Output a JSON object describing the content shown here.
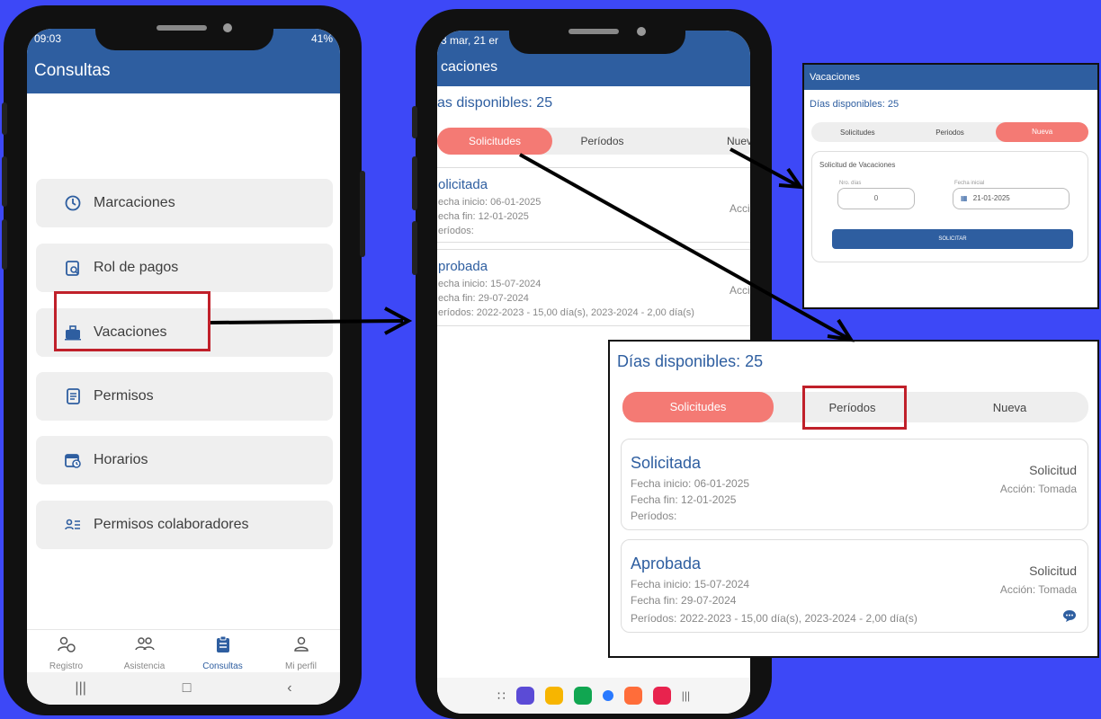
{
  "phone1": {
    "status_time": "09:03",
    "status_battery": "41%",
    "title": "Consultas",
    "menu": [
      {
        "label": "Marcaciones",
        "icon": "clock-check-icon"
      },
      {
        "label": "Rol de pagos",
        "icon": "clipboard-search-icon"
      },
      {
        "label": "Vacaciones",
        "icon": "suitcase-icon"
      },
      {
        "label": "Permisos",
        "icon": "document-icon"
      },
      {
        "label": "Horarios",
        "icon": "calendar-clock-icon"
      },
      {
        "label": "Permisos colaboradores",
        "icon": "users-list-icon"
      }
    ],
    "nav": [
      {
        "label": "Registro",
        "icon": "user-clock-icon"
      },
      {
        "label": "Asistencia",
        "icon": "users-icon"
      },
      {
        "label": "Consultas",
        "icon": "clipboard-icon"
      },
      {
        "label": "Mi perfil",
        "icon": "profile-icon"
      }
    ]
  },
  "phone2": {
    "status_text": "3 mar, 21 er",
    "title": "caciones",
    "available": "as disponibles: 25",
    "tabs": [
      "Solicitudes",
      "Períodos",
      "Nuev"
    ],
    "cards": [
      {
        "title": "olicitada",
        "l1": "echa inicio: 06-01-2025",
        "l2": "echa fin: 12-01-2025",
        "l3": "eríodos:",
        "right": "Acci"
      },
      {
        "title": "probada",
        "l1": "echa inicio: 15-07-2024",
        "l2": "echa fin: 29-07-2024",
        "l3": "eríodos: 2022-2023 - 15,00 día(s), 2023-2024 - 2,00 día(s)",
        "right": "Acci"
      }
    ]
  },
  "panel_top": {
    "header": "Vacaciones",
    "available": "Días disponibles: 25",
    "tabs": [
      "Solicitudes",
      "Periodos",
      "Nueva"
    ],
    "form_title": "Solicitud de Vacaciones",
    "days_label": "Nro. días",
    "days_value": "0",
    "date_label": "Fecha inicial",
    "date_value": "21-01-2025",
    "submit": "SOLICITAR"
  },
  "panel_bottom": {
    "available": "Días disponibles: 25",
    "tabs": [
      "Solicitudes",
      "Períodos",
      "Nueva"
    ],
    "cards": [
      {
        "title": "Solicitada",
        "l1": "Fecha inicio: 06-01-2025",
        "l2": "Fecha fin: 12-01-2025",
        "l3": "Períodos:",
        "type": "Solicitud",
        "action": "Acción: Tomada"
      },
      {
        "title": "Aprobada",
        "l1": "Fecha inicio: 15-07-2024",
        "l2": "Fecha fin: 29-07-2024",
        "l3": "Períodos: 2022-2023 - 15,00 día(s), 2023-2024 - 2,00 día(s)",
        "type": "Solicitud",
        "action": "Acción: Tomada"
      }
    ]
  },
  "colors": {
    "primary": "#2e5ea0",
    "accent": "#f47a74",
    "background": "#3d48f7",
    "highlight": "#c0202a"
  }
}
